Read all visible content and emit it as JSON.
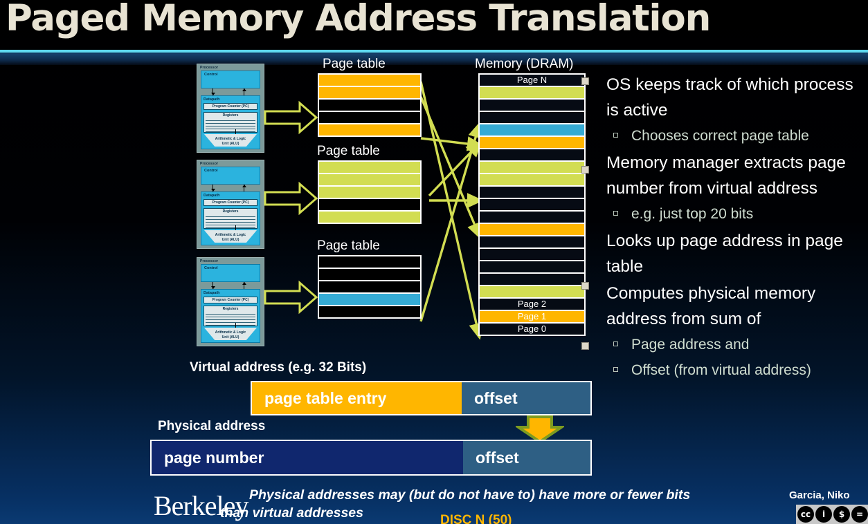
{
  "slide": {
    "title": "Paged Memory Address Translation"
  },
  "diagram": {
    "processor_label": "Processor",
    "control_label": "Control",
    "datapath_label": "Datapath",
    "pc_label": "Program Counter (PC)",
    "registers_label": "Registers",
    "alu_label_line1": "Arithmetic & Logic",
    "alu_label_line2": "Unit (ALU)",
    "page_table_label": "Page table",
    "memory_label": "Memory (DRAM)",
    "page_tables": [
      {
        "label": "Page table",
        "rows": [
          "orange",
          "orange",
          "black",
          "black",
          "orange"
        ]
      },
      {
        "label": "Page table",
        "rows": [
          "green",
          "green",
          "green",
          "black",
          "green"
        ]
      },
      {
        "label": "Page table",
        "rows": [
          "black",
          "black",
          "black",
          "cyan",
          "black"
        ]
      }
    ],
    "memory_rows": [
      {
        "color": "black",
        "label": "Page N"
      },
      {
        "color": "green",
        "label": ""
      },
      {
        "color": "black",
        "label": ""
      },
      {
        "color": "black",
        "label": ""
      },
      {
        "color": "cyan",
        "label": ""
      },
      {
        "color": "orange",
        "label": ""
      },
      {
        "color": "black",
        "label": ""
      },
      {
        "color": "green",
        "label": ""
      },
      {
        "color": "green",
        "label": ""
      },
      {
        "color": "black",
        "label": ""
      },
      {
        "color": "black",
        "label": ""
      },
      {
        "color": "black",
        "label": ""
      },
      {
        "color": "orange",
        "label": ""
      },
      {
        "color": "black",
        "label": ""
      },
      {
        "color": "black",
        "label": ""
      },
      {
        "color": "black",
        "label": ""
      },
      {
        "color": "black",
        "label": ""
      },
      {
        "color": "green",
        "label": ""
      },
      {
        "color": "black",
        "label": "Page 2"
      },
      {
        "color": "orange",
        "label": "Page 1"
      },
      {
        "color": "black",
        "label": "Page 0"
      }
    ]
  },
  "bullets": [
    {
      "level": 1,
      "text": "OS keeps track of which process is active"
    },
    {
      "level": 2,
      "text": "Chooses correct page table"
    },
    {
      "level": 1,
      "text": "Memory manager extracts page number from virtual address"
    },
    {
      "level": 2,
      "text": "e.g. just top 20 bits"
    },
    {
      "level": 1,
      "text": "Looks up page address in page table"
    },
    {
      "level": 1,
      "text": "Computes physical memory address from sum of"
    },
    {
      "level": 2,
      "text": "Page address and"
    },
    {
      "level": 2,
      "text": "Offset (from virtual address)"
    }
  ],
  "address": {
    "virtual_label": "Virtual address (e.g. 32 Bits)",
    "virtual_field": "page table entry",
    "virtual_offset": "offset",
    "physical_label": "Physical address",
    "physical_field": "page number",
    "physical_offset": "offset"
  },
  "footer": {
    "note_line1": "Physical addresses may (but do not have to) have more or fewer bits",
    "note_line2": "than virtual addresses",
    "institution": "Berkeley",
    "author": "Garcia, Niko",
    "cc_marks": [
      "cc",
      "i",
      "$",
      "="
    ],
    "course_tag": "DISC N (50)"
  },
  "colors": {
    "orange": "#ffb600",
    "green": "#d2dd52",
    "cyan": "#35abd4",
    "steel": "#2e5f84",
    "navy": "#10276e",
    "title": "#e8e3d3",
    "rule": "#5ed8ee"
  }
}
